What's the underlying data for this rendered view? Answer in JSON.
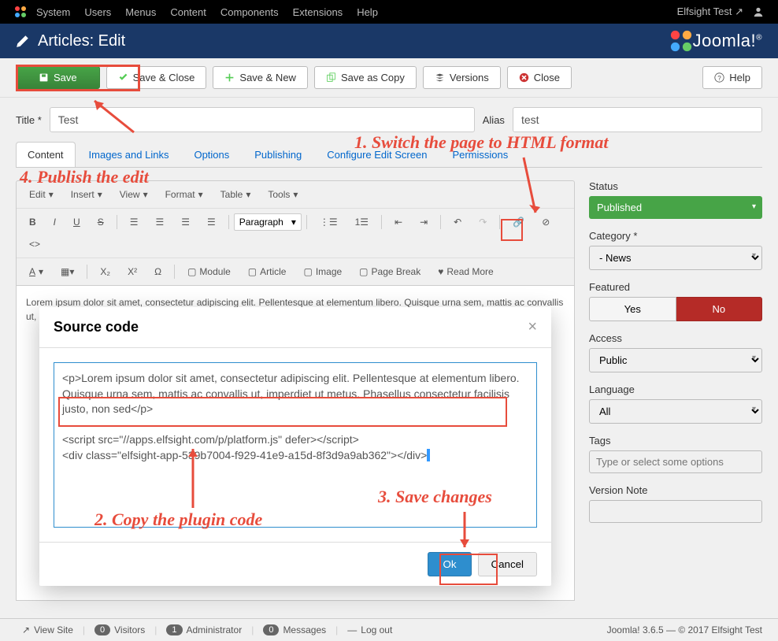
{
  "topnav": {
    "items": [
      "System",
      "Users",
      "Menus",
      "Content",
      "Components",
      "Extensions",
      "Help"
    ],
    "user": "Elfsight Test"
  },
  "header": {
    "title": "Articles: Edit",
    "brand": "Joomla!"
  },
  "toolbar": {
    "save": "Save",
    "save_close": "Save & Close",
    "save_new": "Save & New",
    "save_copy": "Save as Copy",
    "versions": "Versions",
    "close": "Close",
    "help": "Help"
  },
  "title_row": {
    "title_label": "Title *",
    "title_value": "Test",
    "alias_label": "Alias",
    "alias_value": "test"
  },
  "tabs": [
    "Content",
    "Images and Links",
    "Options",
    "Publishing",
    "Configure Edit Screen",
    "Permissions"
  ],
  "editor_menus": [
    "Edit",
    "Insert",
    "View",
    "Format",
    "Table",
    "Tools"
  ],
  "editor_paragraph": "Paragraph",
  "editor_buttons": {
    "module": "Module",
    "article": "Article",
    "image": "Image",
    "pagebreak": "Page Break",
    "readmore": "Read More"
  },
  "editor_content": "Lorem ipsum dolor sit amet, consectetur adipiscing elit. Pellentesque at elementum libero. Quisque urna sem, mattis ac convallis ut, imperdiet ut metus. Phasellus consectetur facilisis justo, non sed",
  "modal": {
    "title": "Source code",
    "line1": "<p>Lorem ipsum dolor sit amet, consectetur adipiscing elit. Pellentesque at elementum libero. Quisque urna sem, mattis ac convallis ut, imperdiet ut metus. Phasellus consectetur facilisis justo, non sed</p>",
    "line2": "<script src=\"//apps.elfsight.com/p/platform.js\" defer></script>",
    "line3": "<div class=\"elfsight-app-539b7004-f929-41e9-a15d-8f3d9a9ab362\"></div>",
    "ok": "Ok",
    "cancel": "Cancel"
  },
  "sidebar": {
    "status_label": "Status",
    "status_value": "Published",
    "category_label": "Category",
    "category_value": "- News",
    "featured_label": "Featured",
    "featured_yes": "Yes",
    "featured_no": "No",
    "access_label": "Access",
    "access_value": "Public",
    "language_label": "Language",
    "language_value": "All",
    "tags_label": "Tags",
    "tags_placeholder": "Type or select some options",
    "version_label": "Version Note"
  },
  "footer": {
    "view_site": "View Site",
    "visitors_count": "0",
    "visitors": "Visitors",
    "admin_count": "1",
    "admin": "Administrator",
    "messages_count": "0",
    "messages": "Messages",
    "logout": "Log out",
    "version": "Joomla! 3.6.5 — © 2017 Elfsight Test"
  },
  "annotations": {
    "a1": "1. Switch the page to HTML format",
    "a2": "2. Copy the plugin code",
    "a3": "3. Save changes",
    "a4": "4. Publish the edit"
  }
}
